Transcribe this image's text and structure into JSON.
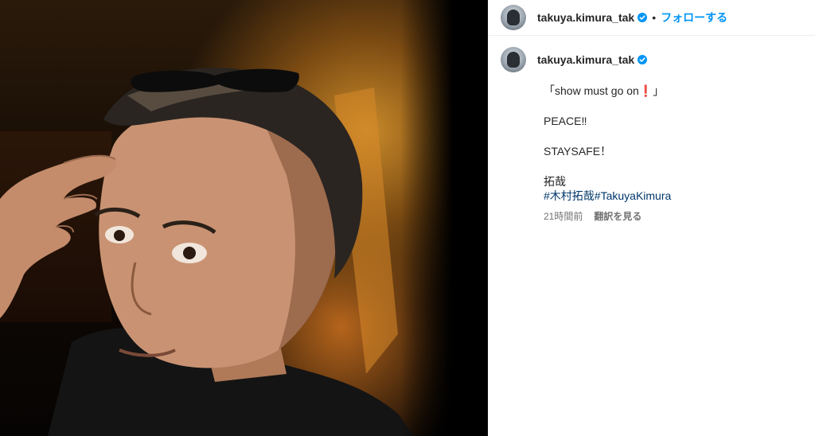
{
  "post": {
    "username": "takuya.kimura_tak",
    "verified_icon": "verified-badge-icon",
    "separator": "•",
    "follow_label": "フォローする",
    "accent_color": "#0095f6"
  },
  "caption": {
    "username": "takuya.kimura_tak",
    "line1": "「show must go on❗」",
    "line2": "PEACE‼",
    "line3": "STAYSAFE！",
    "signature": "拓哉",
    "hashtag1": "#木村拓哉",
    "hashtag2": "#TakuyaKimura",
    "time_ago": "21時間前",
    "translate_label": "翻訳を見る"
  }
}
